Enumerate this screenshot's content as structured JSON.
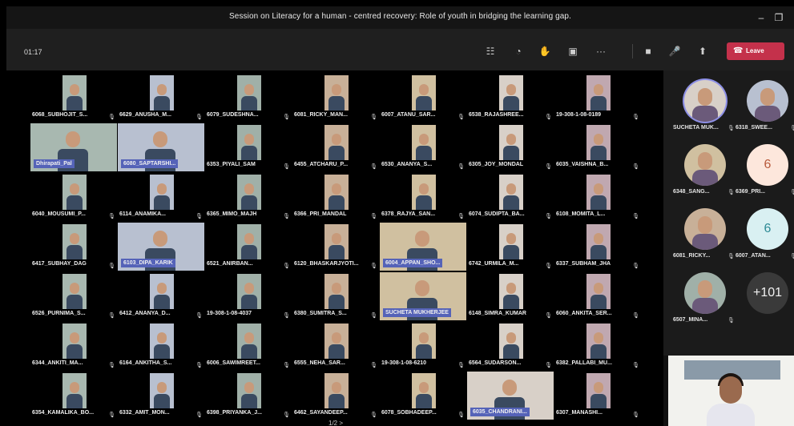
{
  "window": {
    "title": "Session on Literacy for a human - centred recovery: Role of youth in bridging the learning gap.",
    "minimize_icon": "minimize-icon",
    "restore_icon": "restore-icon"
  },
  "toolbar": {
    "timer": "01:17",
    "leave_label": "Leave",
    "icons": [
      "people-icon",
      "chat-icon",
      "raise-hand-icon",
      "rooms-icon",
      "more-icon",
      "camera-icon",
      "mic-icon",
      "share-icon"
    ]
  },
  "colors": {
    "leave": "#c4314b",
    "spotlight_label": "#5563b8"
  },
  "grid": {
    "tiles": [
      {
        "name": "6068_SUBHOJIT_S..."
      },
      {
        "name": "6629_ANUSHA_M..."
      },
      {
        "name": "6079_SUDESHNA..."
      },
      {
        "name": "6081_RICKY_MAN..."
      },
      {
        "name": "6007_ATANU_SAR..."
      },
      {
        "name": "6538_RAJASHREE..."
      },
      {
        "name": "19-308-1-08-0189"
      },
      {
        "name": "Dhirapati_Pal",
        "wide": true
      },
      {
        "name": "6080_SAPTARSHI...",
        "wide": true
      },
      {
        "name": "6353_PIYALI_SAM"
      },
      {
        "name": "6455_ATCHARU_P..."
      },
      {
        "name": "6530_ANANYA_S..."
      },
      {
        "name": "6305_JOY_MONDAL"
      },
      {
        "name": "6035_VAISHNA_B..."
      },
      {
        "name": "6040_MOUSUMI_P..."
      },
      {
        "name": "6114_ANAMIKA..."
      },
      {
        "name": "6365_MIMO_MAJH"
      },
      {
        "name": "6366_PRI_MANDAL"
      },
      {
        "name": "6378_RAJYA_SAN..."
      },
      {
        "name": "6074_SUDIPTA_BA..."
      },
      {
        "name": "6108_MOMITA_L..."
      },
      {
        "name": "6417_SUBHAY_DAG"
      },
      {
        "name": "6103_DIPA_KARIK",
        "wide": true
      },
      {
        "name": "6521_ANIRBAN..."
      },
      {
        "name": "6120_BHASKARJYOTI..."
      },
      {
        "name": "6004_APPAN_SHO...",
        "wide": true
      },
      {
        "name": "6742_URMILA_M..."
      },
      {
        "name": "6337_SUBHAM_JHA"
      },
      {
        "name": "6526_PURNIMA_S..."
      },
      {
        "name": "6412_ANANYA_D..."
      },
      {
        "name": "19-308-1-08-4037"
      },
      {
        "name": "6380_SUMITRA_S..."
      },
      {
        "name": "SUCHETA MUKHERJEE",
        "wide": true
      },
      {
        "name": "6148_SIMRA_KUMAR"
      },
      {
        "name": "6060_ANKITA_SER..."
      },
      {
        "name": "6344_ANKITI_MA..."
      },
      {
        "name": "6164_ANKITHA_S..."
      },
      {
        "name": "6006_SAWIMREET..."
      },
      {
        "name": "6555_NEHA_SAR..."
      },
      {
        "name": "19-308-1-08-6210"
      },
      {
        "name": "6564_SUDARSON..."
      },
      {
        "name": "6382_PALLABI_MU..."
      },
      {
        "name": "6354_KAMALIKA_BO..."
      },
      {
        "name": "6332_AMIT_MON..."
      },
      {
        "name": "6398_PRIYANKA_J..."
      },
      {
        "name": "6462_SAYANDEEP..."
      },
      {
        "name": "6078_SOBHADEEP..."
      },
      {
        "name": "6035_CHANDRANI...",
        "wide": true
      },
      {
        "name": "6307_MANASHI..."
      }
    ],
    "pager": "1/2 >"
  },
  "side_panel": {
    "people": [
      {
        "name": "SUCHETA MUK...",
        "type": "photo"
      },
      {
        "name": "6318_SWEE...",
        "type": "photo"
      },
      {
        "name": "6348_SANG...",
        "type": "photo"
      },
      {
        "name": "6369_PRI...",
        "type": "initial",
        "initial": "6",
        "bg": "#fde7dc",
        "fg": "#b85a3c"
      },
      {
        "name": "6081_RICKY...",
        "type": "photo"
      },
      {
        "name": "6007_ATAN...",
        "type": "initial",
        "initial": "6",
        "bg": "#d9f0f2",
        "fg": "#2d8a95"
      },
      {
        "name": "6507_MINA...",
        "type": "photo"
      },
      {
        "name": "",
        "type": "overflow",
        "initial": "+101",
        "bg": "#3a3a3a",
        "fg": "#f0f0f0"
      }
    ]
  },
  "self_view": {
    "label": "self-view-video"
  }
}
